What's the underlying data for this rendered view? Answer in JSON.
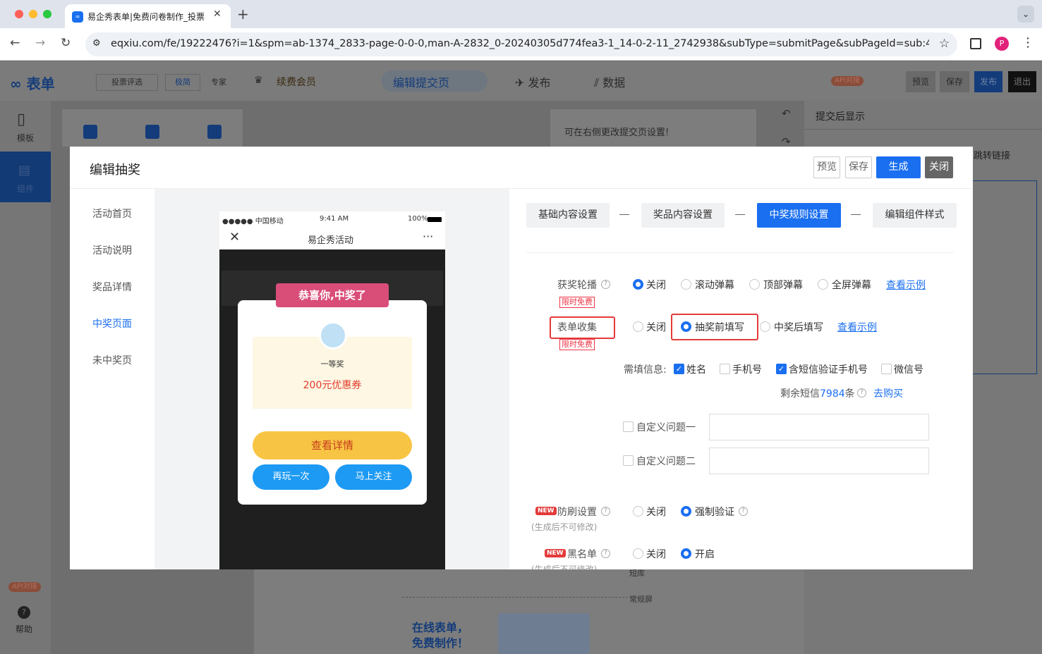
{
  "browser": {
    "tab_title": "易企秀表单|免费问卷制作_投票",
    "url": "eqxiu.com/fe/19222476?i=1&spm=ab-1374_2833-page-0-0-0,man-A-2832_0-20240305d774fea3-1_14-0-2-11_2742938&subType=submitPage&subPageId=sub:4281472161",
    "profile_initial": "P"
  },
  "app": {
    "logo": "表单",
    "toolbar_left": [
      "投票评选",
      "极简",
      "专家"
    ],
    "vip": "续费会员",
    "center_tabs": [
      "编辑提交页",
      "发布",
      "数据"
    ],
    "api_badge": "API对接",
    "right_buttons": [
      "预览",
      "保存",
      "发布",
      "退出"
    ],
    "sidebar": [
      "模板",
      "组件"
    ],
    "help": "帮助",
    "canvas_notice": "可在右侧更改提交页设置!",
    "right_panel_title": "提交后显示",
    "right_panel_link": "跳转链接",
    "bg_labels": [
      "短库",
      "常规屏"
    ],
    "promo": "在线表单，免费制作！"
  },
  "modal": {
    "title": "编辑抽奖",
    "buttons": {
      "preview": "预览",
      "save": "保存",
      "generate": "生成",
      "close": "关闭"
    },
    "menu": [
      "活动首页",
      "活动说明",
      "奖品详情",
      "中奖页面",
      "未中奖页"
    ],
    "phone": {
      "carrier": "●●●●● 中国移动",
      "time": "9:41 AM",
      "battery": "100%",
      "title": "易企秀活动",
      "ribbon": "恭喜你,中奖了",
      "prize_level": "一等奖",
      "prize_name": "200元优惠券",
      "detail_button": "查看详情",
      "again_button": "再玩一次",
      "follow_button": "马上关注"
    },
    "steps": [
      "基础内容设置",
      "奖品内容设置",
      "中奖规则设置",
      "编辑组件样式"
    ],
    "broadcast": {
      "label": "获奖轮播",
      "tag": "限时免费",
      "options": [
        "关闭",
        "滚动弹幕",
        "顶部弹幕",
        "全屏弹幕"
      ],
      "selected": 0,
      "example": "查看示例"
    },
    "form_collect": {
      "label": "表单收集",
      "tag": "限时免费",
      "options": [
        "关闭",
        "抽奖前填写",
        "中奖后填写"
      ],
      "selected": 1,
      "example": "查看示例"
    },
    "required_info": {
      "label": "需填信息:",
      "options": [
        "姓名",
        "手机号",
        "含短信验证手机号",
        "微信号"
      ],
      "checked": [
        true,
        false,
        true,
        false
      ]
    },
    "sms": {
      "prefix": "剩余短信",
      "count": "7984",
      "suffix": "条",
      "buy": "去购买"
    },
    "custom_questions": [
      "自定义问题一",
      "自定义问题二"
    ],
    "anti_fraud": {
      "new": "NEW",
      "label": "防刷设置",
      "note": "(生成后不可修改)",
      "options": [
        "关闭",
        "强制验证"
      ],
      "selected": 1
    },
    "blacklist": {
      "new": "NEW",
      "label": "黑名单",
      "note": "(生成后不可修改)",
      "options": [
        "关闭",
        "开启"
      ],
      "selected": 1
    }
  },
  "colors": {
    "primary": "#1a6ff0",
    "highlight": "#e43a3a"
  }
}
